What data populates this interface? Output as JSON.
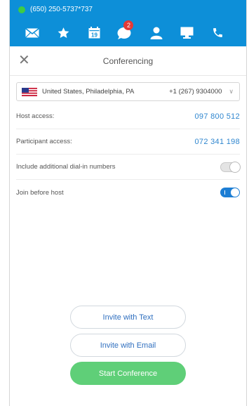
{
  "status_bar": {
    "phone_number": "(650) 250-5737*737"
  },
  "toolbar": {
    "items": [
      {
        "icon": "mail-icon"
      },
      {
        "icon": "star-icon"
      },
      {
        "icon": "calendar-icon",
        "calendar_day": "19"
      },
      {
        "icon": "chat-icon",
        "badge": "2"
      },
      {
        "icon": "person-icon"
      },
      {
        "icon": "monitor-icon"
      },
      {
        "icon": "phone-icon"
      }
    ],
    "accent_color": "#0d8fd8"
  },
  "header": {
    "title": "Conferencing",
    "close_icon": "close-icon"
  },
  "country": {
    "name": "United States, Philadelphia, PA",
    "phone": "+1 (267) 9304000"
  },
  "host_access": {
    "label": "Host access:",
    "value": "097 800 512"
  },
  "participant_access": {
    "label": "Participant access:",
    "value": "072 341 198"
  },
  "include_dial_in": {
    "label": "Include additional dial-in numbers",
    "enabled": false
  },
  "join_before_host": {
    "label": "Join before host",
    "enabled": true
  },
  "buttons": {
    "invite_text": "Invite with Text",
    "invite_email": "Invite with Email",
    "start": "Start Conference"
  },
  "colors": {
    "link": "#2f86cf",
    "toggle_on": "#1d7ed4",
    "start_button": "#5fcf78"
  }
}
